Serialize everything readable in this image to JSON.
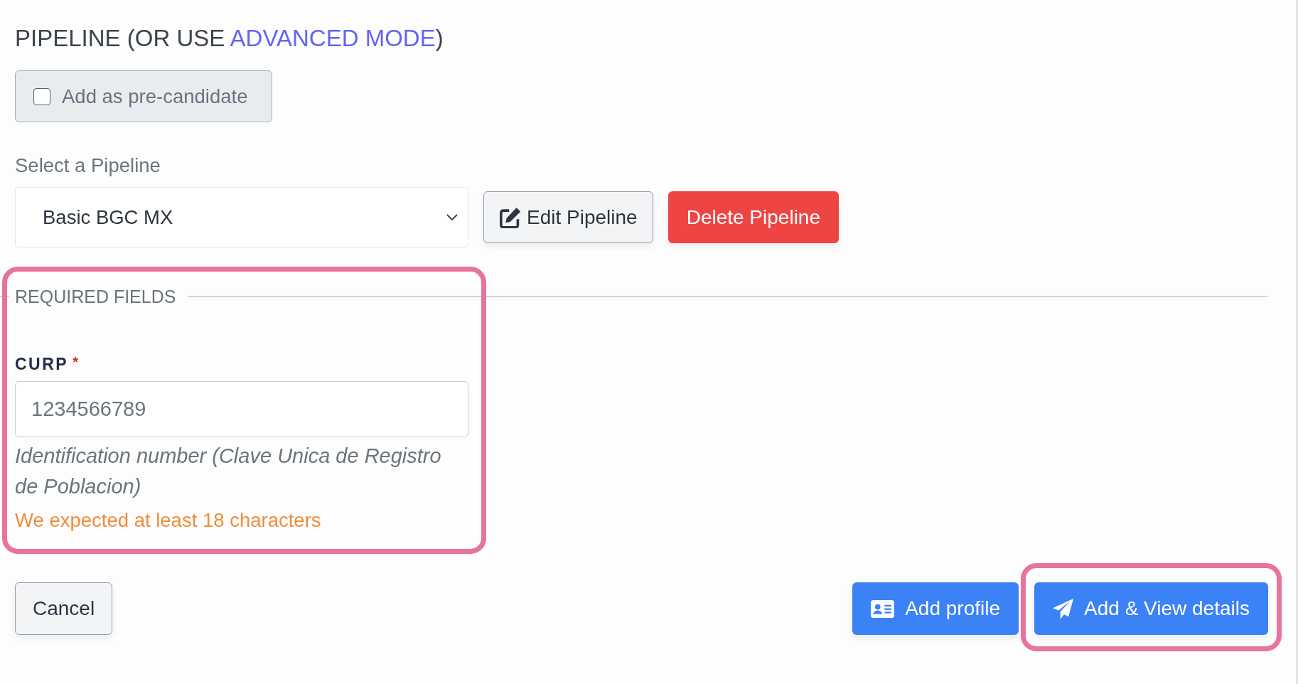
{
  "heading": {
    "before": "PIPELINE (OR USE",
    "link": "ADVANCED MODE",
    "after": ")"
  },
  "pre_candidate": {
    "label": "Add as pre-candidate",
    "checked": false
  },
  "pipeline_select": {
    "label": "Select a Pipeline",
    "value": "Basic BGC MX"
  },
  "pipeline_buttons": [
    {
      "kind": "edit",
      "label": "Edit Pipeline"
    },
    {
      "kind": "delete",
      "label": "Delete Pipeline"
    }
  ],
  "required_fields": {
    "title": "REQUIRED FIELDS",
    "highlighted": true,
    "fields": [
      {
        "label": "CURP",
        "required_mark": "*",
        "value": "1234566789",
        "help": "Identification number (Clave Unica de Registro de Poblacion)",
        "error": "We expected at least 18 characters"
      }
    ]
  },
  "actions": [
    {
      "kind": "cancel",
      "label": "Cancel",
      "highlighted": false
    },
    {
      "kind": "add",
      "label": "Add profile",
      "highlighted": false
    },
    {
      "kind": "add_view",
      "label": "Add & View details",
      "highlighted": true
    }
  ]
}
